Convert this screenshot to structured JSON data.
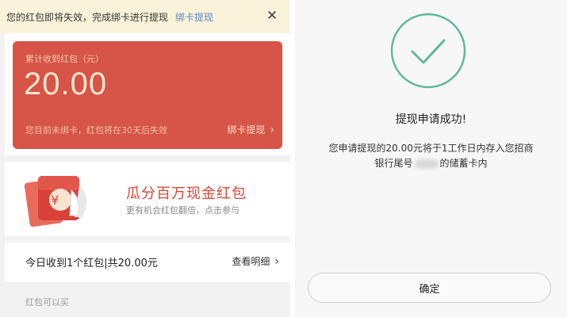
{
  "notice": {
    "text": "您的红包即将失效，完成绑卡进行提现",
    "link": "绑卡提现",
    "close_icon": "close-icon"
  },
  "card": {
    "label": "累计收到红包（元）",
    "amount": "20.00",
    "note": "您目前未绑卡，红包将在30天后失效",
    "bind": "绑卡提现"
  },
  "promo": {
    "title": "瓜分百万现金红包",
    "sub": "更有机会红包翻倍，点击参与"
  },
  "today": {
    "text": "今日收到1个红包|共20.00元",
    "more": "查看明细"
  },
  "caption": "红包可以买",
  "result": {
    "title": "提现申请成功!",
    "line1": "您申请提现的20.00元将于1工作日内存入您招商",
    "line2_prefix": "银行尾号",
    "line2_suffix": "的储蓄卡内",
    "confirm": "确定"
  },
  "colors": {
    "accent_red": "#d65448",
    "success_green": "#5fb89a",
    "link_blue": "#5b86c9"
  }
}
